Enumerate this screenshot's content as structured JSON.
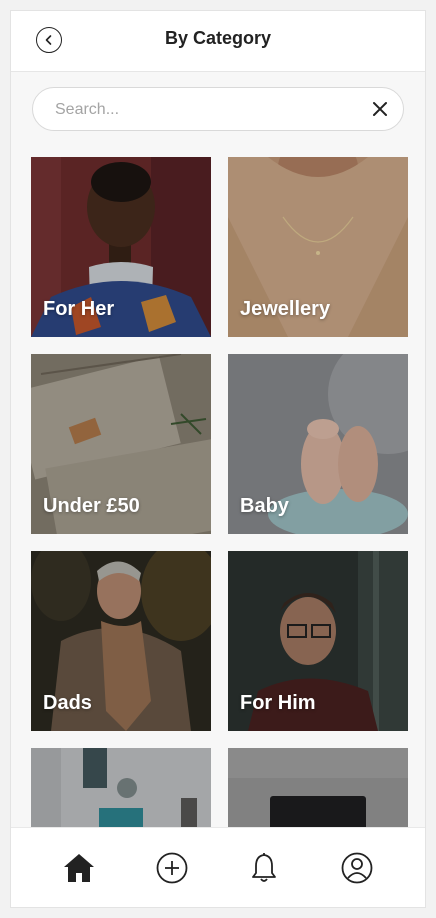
{
  "header": {
    "title": "By Category",
    "back_icon": "chevron-left-circle-icon"
  },
  "search": {
    "placeholder": "Search...",
    "value": "",
    "clear_icon": "close-icon"
  },
  "categories": [
    {
      "label": "For Her"
    },
    {
      "label": "Jewellery"
    },
    {
      "label": "Under £50"
    },
    {
      "label": "Baby"
    },
    {
      "label": "Dads"
    },
    {
      "label": "For Him"
    },
    {
      "label": ""
    },
    {
      "label": ""
    }
  ],
  "tab_bar": {
    "items": [
      {
        "icon": "home-icon",
        "active": true
      },
      {
        "icon": "add-circle-icon",
        "active": false
      },
      {
        "icon": "bell-icon",
        "active": false
      },
      {
        "icon": "account-icon",
        "active": false
      }
    ],
    "active_color": "#222222"
  }
}
